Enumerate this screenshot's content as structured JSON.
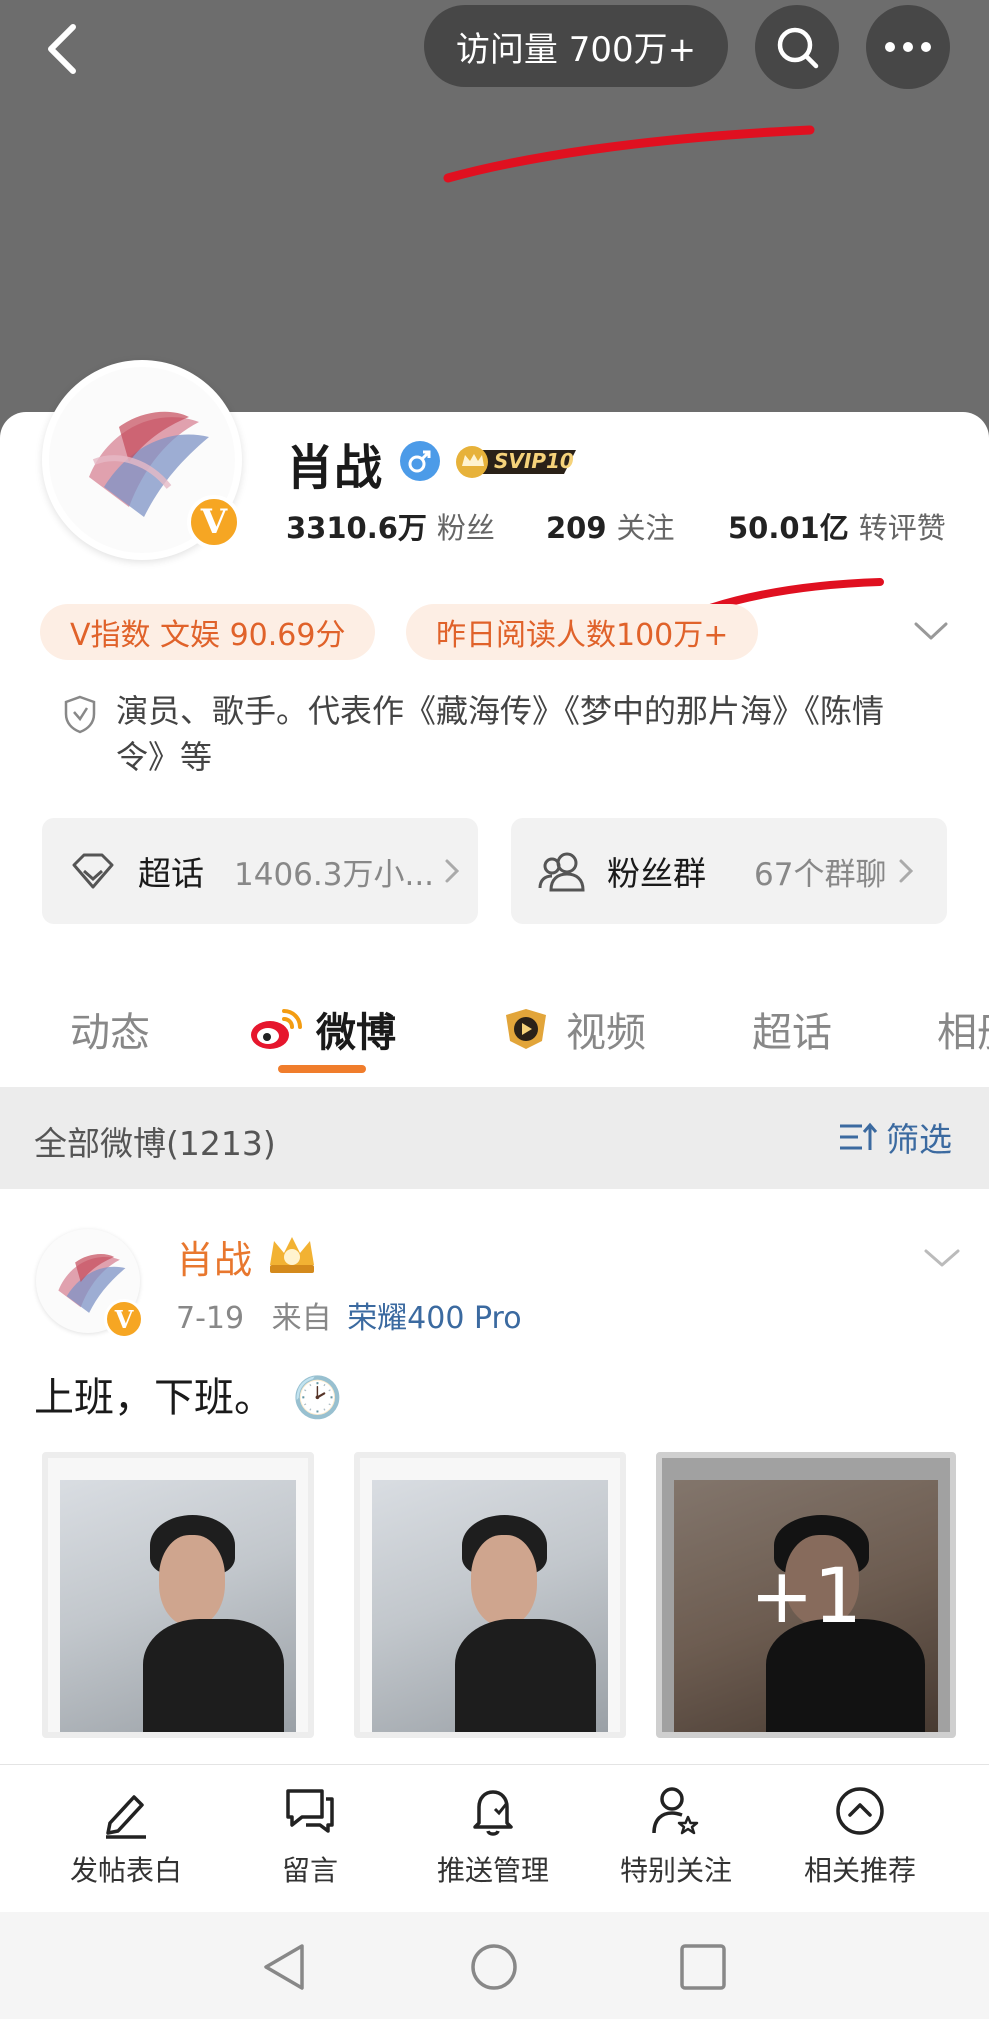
{
  "header": {
    "visits_label": "访问量 700万+"
  },
  "profile": {
    "name": "肖战",
    "verified_badge": "V",
    "gender": "male",
    "vip_badge": "SVIP10",
    "stats": [
      {
        "num": "3310.6万",
        "label": "粉丝"
      },
      {
        "num": "209",
        "label": "关注"
      },
      {
        "num": "50.01亿",
        "label": "转评赞"
      }
    ],
    "tags": [
      "V指数 文娱 90.69分",
      "昨日阅读人数100万+"
    ],
    "bio": "演员、歌手。代表作《藏海传》《梦中的那片海》《陈情令》等"
  },
  "entries": [
    {
      "title": "超话",
      "sub": "1406.3万小...",
      "icon": "diamond-icon"
    },
    {
      "title": "粉丝群",
      "sub": "67个群聊",
      "icon": "group-icon"
    }
  ],
  "tabs": [
    "动态",
    "微博",
    "视频",
    "超话",
    "相册"
  ],
  "active_tab": "微博",
  "filter": {
    "count_label": "全部微博(1213)",
    "filter_label": "筛选"
  },
  "post": {
    "author": "肖战",
    "date": "7-19",
    "from_prefix": "来自",
    "source": "荣耀400 Pro",
    "text": "上班，下班。",
    "emoji": "🕑",
    "more_label": "+1"
  },
  "actions": [
    {
      "label": "发帖表白",
      "icon": "pencil-icon"
    },
    {
      "label": "留言",
      "icon": "comment-icon"
    },
    {
      "label": "推送管理",
      "icon": "bell-icon"
    },
    {
      "label": "特别关注",
      "icon": "user-star-icon"
    },
    {
      "label": "相关推荐",
      "icon": "chevron-up-circle-icon"
    }
  ],
  "colors": {
    "accent": "#f07d2c",
    "link": "#3b6aa0",
    "tag_bg": "#fdeee4",
    "annotation": "#e01020"
  }
}
